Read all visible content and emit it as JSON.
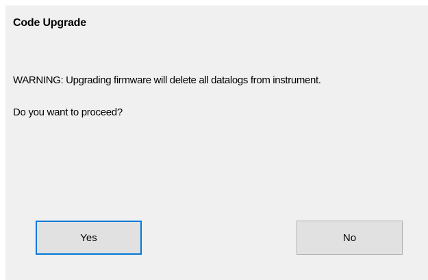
{
  "dialog": {
    "title": "Code Upgrade",
    "warning": "WARNING: Upgrading firmware will delete all datalogs from instrument.",
    "question": "Do you want to proceed?",
    "buttons": {
      "yes_label": "Yes",
      "no_label": "No"
    }
  },
  "colors": {
    "dialog_background": "#f0f0f0",
    "button_background": "#e1e1e1",
    "button_border": "#adadad",
    "focus_border": "#0078d7",
    "text": "#000000"
  }
}
